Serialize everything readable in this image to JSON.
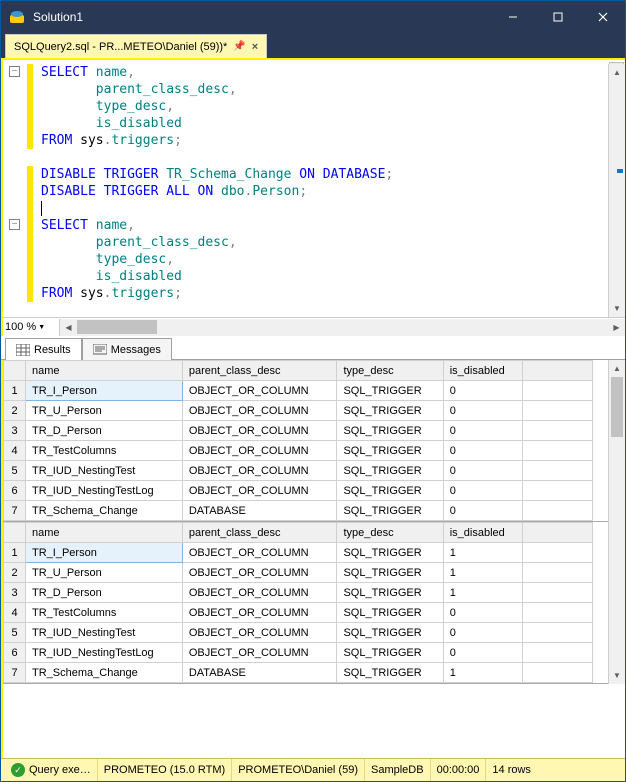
{
  "window": {
    "title": "Solution1"
  },
  "tab": {
    "label": "SQLQuery2.sql - PR...METEO\\Daniel (59))*"
  },
  "editor": {
    "zoom": "100 %",
    "code_lines": [
      [
        {
          "t": "SELECT",
          "c": "kw"
        },
        {
          "t": " name",
          "c": "ident"
        },
        {
          "t": ",",
          "c": "op"
        }
      ],
      [
        {
          "t": "       parent_class_desc",
          "c": "ident"
        },
        {
          "t": ",",
          "c": "op"
        }
      ],
      [
        {
          "t": "       type_desc",
          "c": "ident"
        },
        {
          "t": ",",
          "c": "op"
        }
      ],
      [
        {
          "t": "       is_disabled",
          "c": "ident"
        }
      ],
      [
        {
          "t": "FROM",
          "c": "kw"
        },
        {
          "t": " ",
          "c": ""
        },
        {
          "t": "sys",
          "c": "func"
        },
        {
          "t": ".",
          "c": "op"
        },
        {
          "t": "triggers",
          "c": "ident"
        },
        {
          "t": ";",
          "c": "op"
        }
      ],
      [],
      [
        {
          "t": "DISABLE TRIGGER",
          "c": "kw"
        },
        {
          "t": " TR_Schema_Change ",
          "c": "ident"
        },
        {
          "t": "ON DATABASE",
          "c": "kw"
        },
        {
          "t": ";",
          "c": "op"
        }
      ],
      [
        {
          "t": "DISABLE TRIGGER",
          "c": "kw"
        },
        {
          "t": " ",
          "c": ""
        },
        {
          "t": "ALL",
          "c": "kw"
        },
        {
          "t": " ",
          "c": ""
        },
        {
          "t": "ON",
          "c": "kw"
        },
        {
          "t": " dbo",
          "c": "ident"
        },
        {
          "t": ".",
          "c": "op"
        },
        {
          "t": "Person",
          "c": "ident"
        },
        {
          "t": ";",
          "c": "op"
        }
      ],
      [
        {
          "t": "|",
          "c": "cursor"
        }
      ],
      [
        {
          "t": "SELECT",
          "c": "kw"
        },
        {
          "t": " name",
          "c": "ident"
        },
        {
          "t": ",",
          "c": "op"
        }
      ],
      [
        {
          "t": "       parent_class_desc",
          "c": "ident"
        },
        {
          "t": ",",
          "c": "op"
        }
      ],
      [
        {
          "t": "       type_desc",
          "c": "ident"
        },
        {
          "t": ",",
          "c": "op"
        }
      ],
      [
        {
          "t": "       is_disabled",
          "c": "ident"
        }
      ],
      [
        {
          "t": "FROM",
          "c": "kw"
        },
        {
          "t": " ",
          "c": ""
        },
        {
          "t": "sys",
          "c": "func"
        },
        {
          "t": ".",
          "c": "op"
        },
        {
          "t": "triggers",
          "c": "ident"
        },
        {
          "t": ";",
          "c": "op"
        }
      ]
    ]
  },
  "result_tabs": {
    "results": "Results",
    "messages": "Messages"
  },
  "grid": {
    "columns": [
      "name",
      "parent_class_desc",
      "type_desc",
      "is_disabled"
    ],
    "set1": [
      [
        "TR_I_Person",
        "OBJECT_OR_COLUMN",
        "SQL_TRIGGER",
        "0"
      ],
      [
        "TR_U_Person",
        "OBJECT_OR_COLUMN",
        "SQL_TRIGGER",
        "0"
      ],
      [
        "TR_D_Person",
        "OBJECT_OR_COLUMN",
        "SQL_TRIGGER",
        "0"
      ],
      [
        "TR_TestColumns",
        "OBJECT_OR_COLUMN",
        "SQL_TRIGGER",
        "0"
      ],
      [
        "TR_IUD_NestingTest",
        "OBJECT_OR_COLUMN",
        "SQL_TRIGGER",
        "0"
      ],
      [
        "TR_IUD_NestingTestLog",
        "OBJECT_OR_COLUMN",
        "SQL_TRIGGER",
        "0"
      ],
      [
        "TR_Schema_Change",
        "DATABASE",
        "SQL_TRIGGER",
        "0"
      ]
    ],
    "set2": [
      [
        "TR_I_Person",
        "OBJECT_OR_COLUMN",
        "SQL_TRIGGER",
        "1"
      ],
      [
        "TR_U_Person",
        "OBJECT_OR_COLUMN",
        "SQL_TRIGGER",
        "1"
      ],
      [
        "TR_D_Person",
        "OBJECT_OR_COLUMN",
        "SQL_TRIGGER",
        "1"
      ],
      [
        "TR_TestColumns",
        "OBJECT_OR_COLUMN",
        "SQL_TRIGGER",
        "0"
      ],
      [
        "TR_IUD_NestingTest",
        "OBJECT_OR_COLUMN",
        "SQL_TRIGGER",
        "0"
      ],
      [
        "TR_IUD_NestingTestLog",
        "OBJECT_OR_COLUMN",
        "SQL_TRIGGER",
        "0"
      ],
      [
        "TR_Schema_Change",
        "DATABASE",
        "SQL_TRIGGER",
        "1"
      ]
    ]
  },
  "status": {
    "exec": "Query exe…",
    "server": "PROMETEO (15.0 RTM)",
    "user": "PROMETEO\\Daniel (59)",
    "db": "SampleDB",
    "time": "00:00:00",
    "rows": "14 rows"
  }
}
